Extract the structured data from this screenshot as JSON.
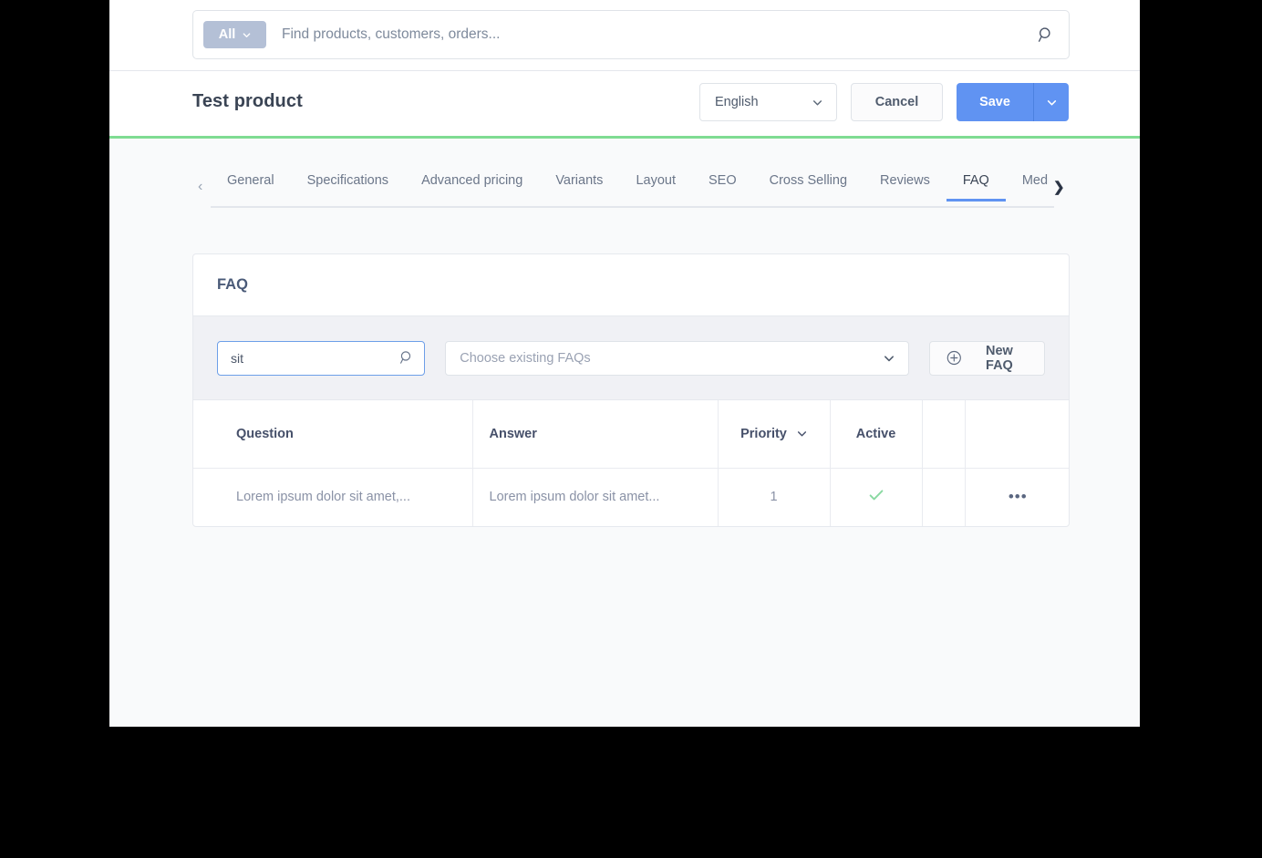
{
  "search": {
    "scope_label": "All",
    "placeholder": "Find products, customers, orders...",
    "value": "",
    "submit_icon": "search-icon"
  },
  "header": {
    "title": "Test product",
    "language": "English",
    "cancel_label": "Cancel",
    "save_label": "Save"
  },
  "tabs": {
    "scroll_left_icon": "chevron-left-icon",
    "scroll_right_icon": "chevron-right-icon",
    "items": [
      {
        "label": "General",
        "active": false
      },
      {
        "label": "Specifications",
        "active": false
      },
      {
        "label": "Advanced pricing",
        "active": false
      },
      {
        "label": "Variants",
        "active": false
      },
      {
        "label": "Layout",
        "active": false
      },
      {
        "label": "SEO",
        "active": false
      },
      {
        "label": "Cross Selling",
        "active": false
      },
      {
        "label": "Reviews",
        "active": false
      },
      {
        "label": "FAQ",
        "active": true
      },
      {
        "label": "Medi",
        "active": false
      }
    ]
  },
  "faq_card": {
    "title": "FAQ",
    "toolbar": {
      "search_value": "sit",
      "search_placeholder": "",
      "search_icon": "search-icon",
      "select_placeholder": "Choose existing FAQs",
      "select_caret_icon": "chevron-down-icon",
      "new_faq_label": "New FAQ",
      "new_faq_icon": "circle-plus-icon"
    },
    "table": {
      "columns": [
        {
          "label": "Question",
          "sortable": false
        },
        {
          "label": "Answer",
          "sortable": false
        },
        {
          "label": "Priority",
          "sortable": true
        },
        {
          "label": "Active",
          "sortable": false
        },
        {
          "label": "",
          "sortable": false
        },
        {
          "label": "",
          "sortable": false
        }
      ],
      "rows": [
        {
          "question": "Lorem ipsum dolor sit amet,...",
          "answer": "Lorem ipsum dolor sit amet...",
          "priority": "1",
          "active": true,
          "active_icon": "check-icon",
          "actions_icon": "ellipsis-icon",
          "actions_label": "•••"
        }
      ]
    }
  },
  "colors": {
    "accent": "#6093f2",
    "progress": "#7fdc92",
    "active_check": "#8ad9a2",
    "page_bg": "#f9fafb",
    "toolbar_bg": "#f0f1f5"
  }
}
